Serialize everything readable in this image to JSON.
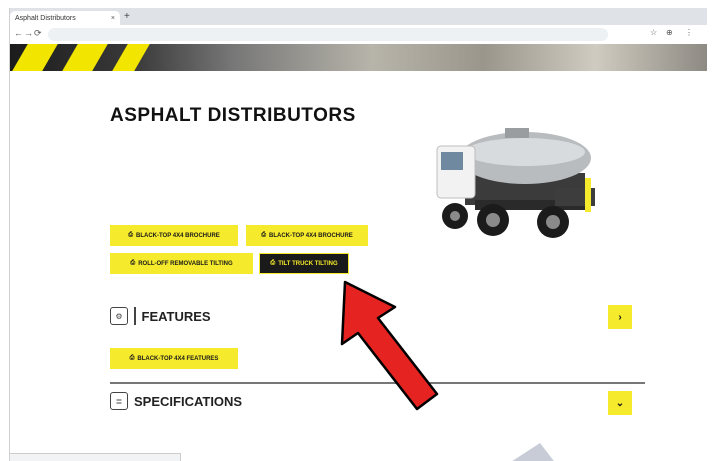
{
  "browser": {
    "tab_title": "Asphalt Distributors",
    "tab_close": "×",
    "new_tab": "+",
    "url": "",
    "back": "←",
    "forward": "→",
    "reload": "⟳",
    "tools": [
      "☆",
      "⊕",
      "⋮"
    ]
  },
  "page": {
    "title": "ASPHALT DISTRIBUTORS",
    "description": "",
    "buttons": [
      {
        "icon": "document-icon",
        "label": "BLACK-TOP 4X4 BROCHURE",
        "style": "yellow"
      },
      {
        "icon": "document-icon",
        "label": "BLACK-TOP 4X4 BROCHURE",
        "style": "yellow"
      },
      {
        "icon": "document-icon",
        "label": "ROLL-OFF REMOVABLE TILTING",
        "style": "yellow"
      },
      {
        "icon": "document-icon",
        "label": "TILT TRUCK TILTING",
        "style": "dark"
      }
    ],
    "features": {
      "label": "FEATURES",
      "chevron": "›",
      "sub_button": "BLACK-TOP 4X4 FEATURES"
    },
    "specifications": {
      "label": "SPECIFICATIONS",
      "chevron": "⌄"
    }
  },
  "annotation": {
    "color": "#e52421",
    "outline": "#000000"
  },
  "colors": {
    "accent_yellow": "#f5ea2b",
    "dark": "#1a1a1a"
  }
}
